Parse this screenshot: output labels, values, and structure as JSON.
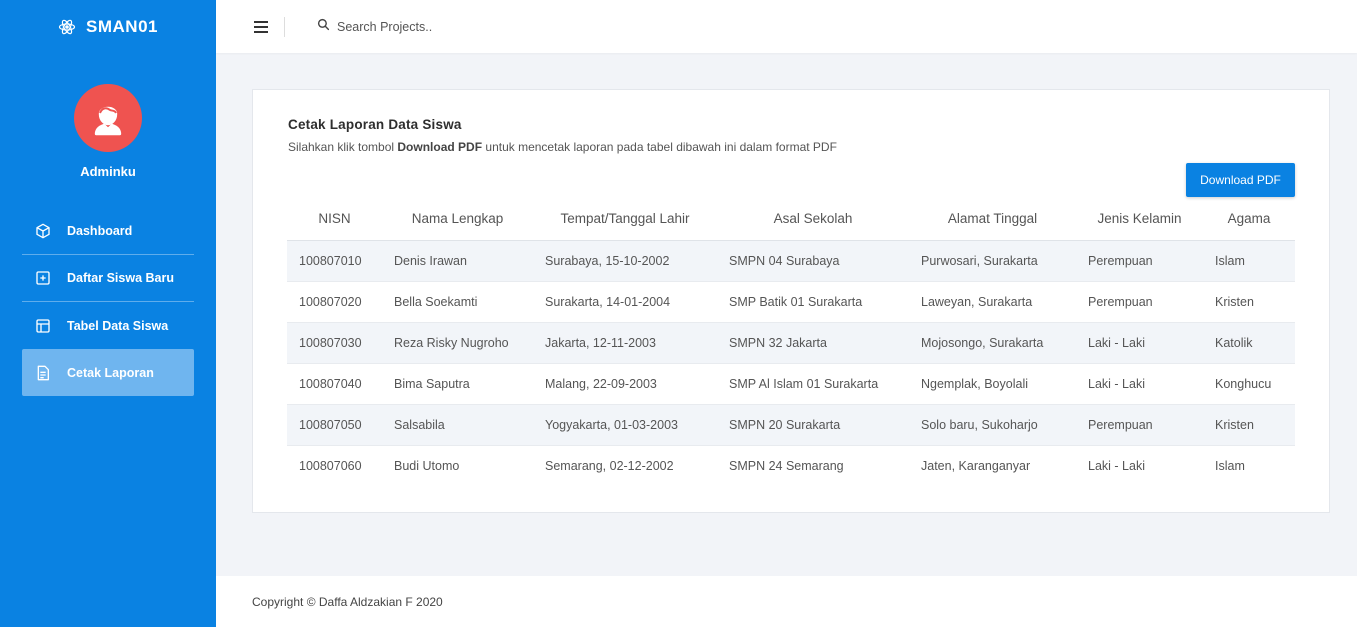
{
  "brand": {
    "name": "SMAN01",
    "icon": "atom-icon"
  },
  "user": {
    "name": "Adminku",
    "icon": "user-avatar-icon",
    "color": "#ef5350"
  },
  "sidebar": {
    "color": "#0a82e2",
    "items": [
      {
        "label": "Dashboard",
        "icon": "cube-icon"
      },
      {
        "label": "Daftar Siswa Baru",
        "icon": "plus-square-icon"
      },
      {
        "label": "Tabel Data Siswa",
        "icon": "layout-icon"
      },
      {
        "label": "Cetak Laporan",
        "icon": "document-icon",
        "active": true
      }
    ]
  },
  "header": {
    "search_placeholder": "Search Projects.."
  },
  "card": {
    "title": "Cetak Laporan Data Siswa",
    "desc_prefix": "Silahkan klik tombol ",
    "desc_bold": "Download PDF",
    "desc_suffix": " untuk mencetak laporan pada tabel dibawah ini dalam format PDF",
    "download_label": "Download PDF"
  },
  "table": {
    "columns": [
      "NISN",
      "Nama Lengkap",
      "Tempat/Tanggal Lahir",
      "Asal Sekolah",
      "Alamat Tinggal",
      "Jenis Kelamin",
      "Agama"
    ],
    "rows": [
      [
        "100807010",
        "Denis Irawan",
        "Surabaya, 15-10-2002",
        "SMPN 04 Surabaya",
        "Purwosari, Surakarta",
        "Perempuan",
        "Islam"
      ],
      [
        "100807020",
        "Bella Soekamti",
        "Surakarta, 14-01-2004",
        "SMP Batik 01 Surakarta",
        "Laweyan, Surakarta",
        "Perempuan",
        "Kristen"
      ],
      [
        "100807030",
        "Reza Risky Nugroho",
        "Jakarta, 12-11-2003",
        "SMPN 32 Jakarta",
        "Mojosongo, Surakarta",
        "Laki - Laki",
        "Katolik"
      ],
      [
        "100807040",
        "Bima Saputra",
        "Malang, 22-09-2003",
        "SMP Al Islam 01 Surakarta",
        "Ngemplak, Boyolali",
        "Laki - Laki",
        "Konghucu"
      ],
      [
        "100807050",
        "Salsabila",
        "Yogyakarta, 01-03-2003",
        "SMPN 20 Surakarta",
        "Solo baru, Sukoharjo",
        "Perempuan",
        "Kristen"
      ],
      [
        "100807060",
        "Budi Utomo",
        "Semarang, 02-12-2002",
        "SMPN 24 Semarang",
        "Jaten, Karanganyar",
        "Laki - Laki",
        "Islam"
      ]
    ]
  },
  "footer": {
    "text": "Copyright © Daffa Aldzakian F 2020"
  }
}
